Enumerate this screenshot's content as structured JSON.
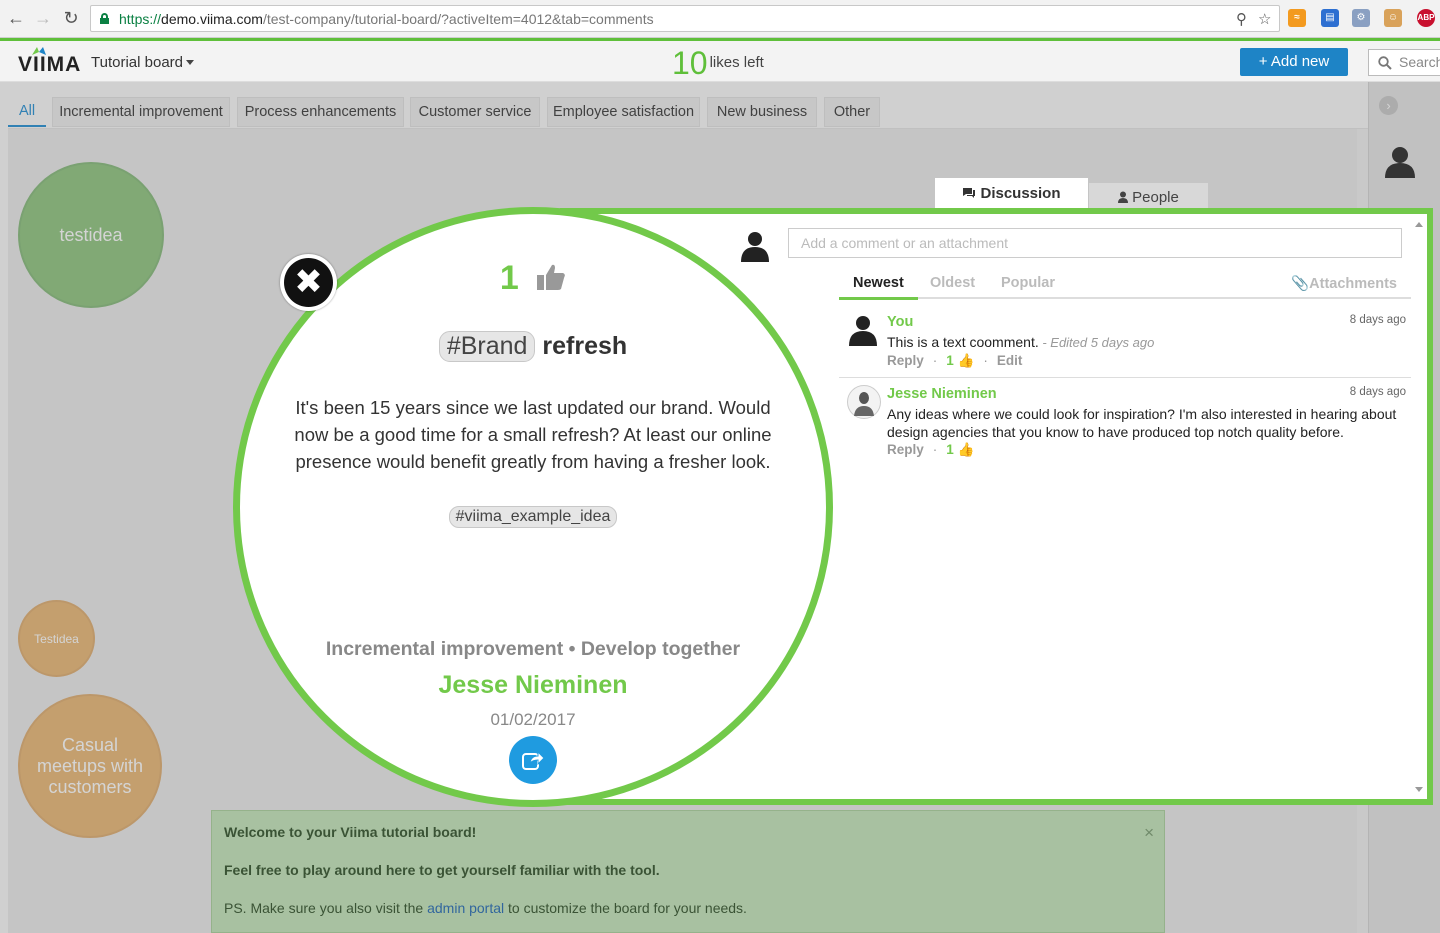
{
  "browser": {
    "url_scheme": "https://",
    "url_host": "demo.viima.com",
    "url_path": "/test-company/tutorial-board/?activeItem=4012&tab=comments",
    "extensions": [
      "rss-icon",
      "calendar-icon",
      "key-icon",
      "face-icon",
      "adblock-icon"
    ],
    "adblock_label": "ABP"
  },
  "header": {
    "logo": "VIIMA",
    "board_name": "Tutorial board",
    "likes_count": "10",
    "likes_label": "likes left",
    "add_button": "+ Add new",
    "search_placeholder": "Search"
  },
  "category_tabs": [
    {
      "label": "All",
      "active": true
    },
    {
      "label": "Incremental improvement"
    },
    {
      "label": "Process enhancements"
    },
    {
      "label": "Customer service"
    },
    {
      "label": "Employee satisfaction"
    },
    {
      "label": "New business"
    },
    {
      "label": "Other"
    }
  ],
  "bubbles": [
    {
      "label": "testidea",
      "color": "green"
    },
    {
      "label": "Testidea",
      "color": "orange"
    },
    {
      "label": "Casual meetups with customers",
      "color": "orange"
    }
  ],
  "welcome": {
    "title": "Welcome to your Viima tutorial board!",
    "line2": "Feel free to play around here to get yourself familiar with the tool.",
    "line3_prefix": "PS. Make sure you also visit the ",
    "line3_link": "admin portal",
    "line3_suffix": " to customize the board for your needs.",
    "close": "×"
  },
  "idea": {
    "likes": "1",
    "hashtag": "#Brand",
    "title_rest": "refresh",
    "description": "It's been 15 years since we last updated our brand. Would now be a good time for a small refresh? At least our online presence would benefit greatly from having a fresher look.",
    "tag": "#viima_example_idea",
    "category_status": "Incremental improvement • Develop together",
    "author": "Jesse Nieminen",
    "date": "01/02/2017"
  },
  "discussion": {
    "tab_discussion": "Discussion",
    "tab_people": "People",
    "input_placeholder": "Add a comment or an attachment",
    "sort_newest": "Newest",
    "sort_oldest": "Oldest",
    "sort_popular": "Popular",
    "attachments": "Attachments",
    "comments": [
      {
        "author": "You",
        "time": "8 days ago",
        "text": "This is a text coomment.",
        "edited": " - Edited 5 days ago",
        "reply": "Reply",
        "likes": "1",
        "edit": "Edit"
      },
      {
        "author": "Jesse Nieminen",
        "time": "8 days ago",
        "text": "Any ideas where we could look for inspiration? I'm also interested in hearing about design agencies that you know to have produced top notch quality before.",
        "reply": "Reply",
        "likes": "1"
      }
    ]
  },
  "colors": {
    "brand_green": "#72c94a",
    "primary_blue": "#1e84c6"
  }
}
